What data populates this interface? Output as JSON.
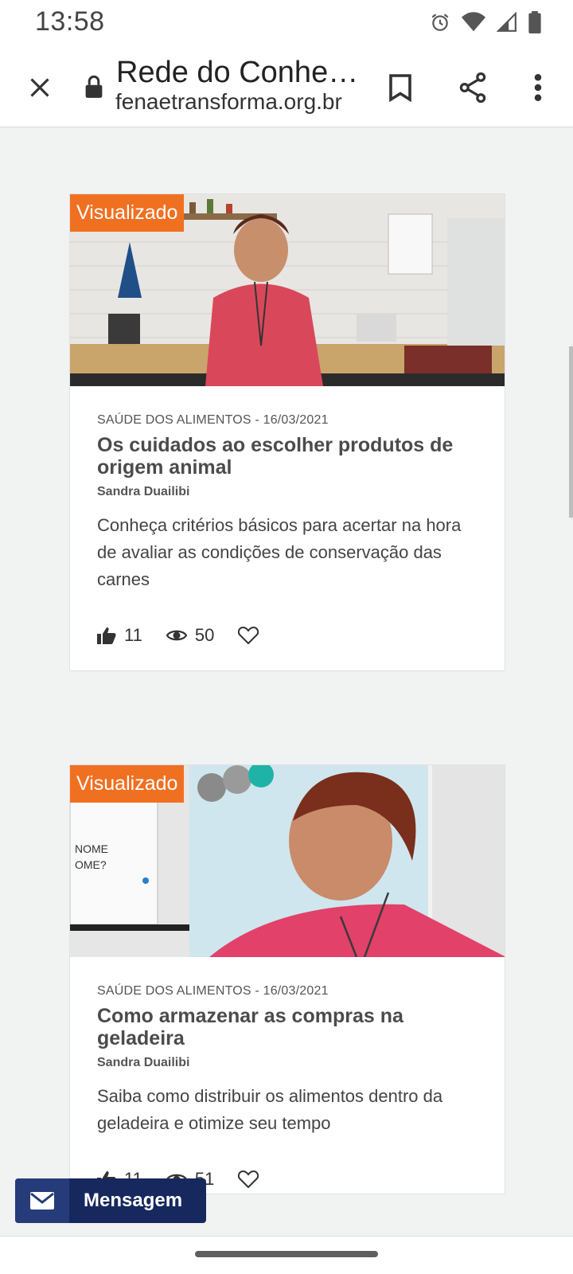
{
  "status": {
    "time": "13:58",
    "icons": [
      "alarm-icon",
      "wifi-icon",
      "signal-icon",
      "battery-icon"
    ]
  },
  "browser": {
    "title": "Rede do Conhe…",
    "url": "fenaetransforma.org.br",
    "icons": [
      "close-icon",
      "lock-icon",
      "bookmark-icon",
      "share-icon",
      "more-vert-icon"
    ]
  },
  "cards": [
    {
      "badge": "Visualizado",
      "meta": "SAÚDE DOS ALIMENTOS - 16/03/2021",
      "title": "Os cuidados ao escolher produtos de origem animal",
      "author": "Sandra Duailibi",
      "description": "Conheça critérios básicos para acertar na hora de avaliar as condições de conservação das carnes",
      "likes": "11",
      "views": "50"
    },
    {
      "badge": "Visualizado",
      "meta": "SAÚDE DOS ALIMENTOS - 16/03/2021",
      "title": "Como armazenar as compras na geladeira",
      "author": "Sandra Duailibi",
      "description": "Saiba como distribuir os alimentos dentro da geladeira e otimize seu tempo",
      "likes": "11",
      "views": "51"
    }
  ],
  "message_button": {
    "label": "Mensagem",
    "icon": "mail-icon"
  },
  "colors": {
    "badge": "#f07022",
    "message_button": "#16285e",
    "background": "#f1f3f3"
  }
}
